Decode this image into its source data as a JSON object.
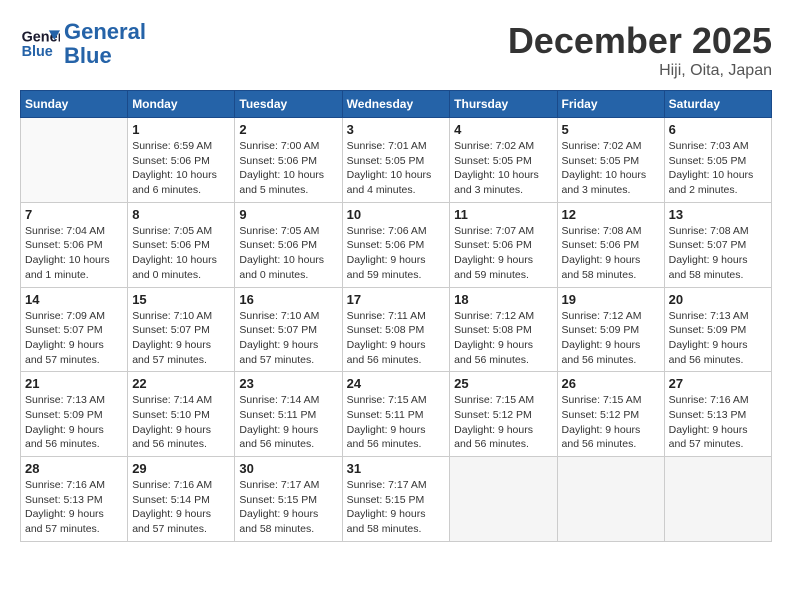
{
  "header": {
    "logo_line1": "General",
    "logo_line2": "Blue",
    "month_title": "December 2025",
    "location": "Hiji, Oita, Japan"
  },
  "days_of_week": [
    "Sunday",
    "Monday",
    "Tuesday",
    "Wednesday",
    "Thursday",
    "Friday",
    "Saturday"
  ],
  "weeks": [
    [
      {
        "day": "",
        "detail": ""
      },
      {
        "day": "1",
        "detail": "Sunrise: 6:59 AM\nSunset: 5:06 PM\nDaylight: 10 hours\nand 6 minutes."
      },
      {
        "day": "2",
        "detail": "Sunrise: 7:00 AM\nSunset: 5:06 PM\nDaylight: 10 hours\nand 5 minutes."
      },
      {
        "day": "3",
        "detail": "Sunrise: 7:01 AM\nSunset: 5:05 PM\nDaylight: 10 hours\nand 4 minutes."
      },
      {
        "day": "4",
        "detail": "Sunrise: 7:02 AM\nSunset: 5:05 PM\nDaylight: 10 hours\nand 3 minutes."
      },
      {
        "day": "5",
        "detail": "Sunrise: 7:02 AM\nSunset: 5:05 PM\nDaylight: 10 hours\nand 3 minutes."
      },
      {
        "day": "6",
        "detail": "Sunrise: 7:03 AM\nSunset: 5:05 PM\nDaylight: 10 hours\nand 2 minutes."
      }
    ],
    [
      {
        "day": "7",
        "detail": "Sunrise: 7:04 AM\nSunset: 5:06 PM\nDaylight: 10 hours\nand 1 minute."
      },
      {
        "day": "8",
        "detail": "Sunrise: 7:05 AM\nSunset: 5:06 PM\nDaylight: 10 hours\nand 0 minutes."
      },
      {
        "day": "9",
        "detail": "Sunrise: 7:05 AM\nSunset: 5:06 PM\nDaylight: 10 hours\nand 0 minutes."
      },
      {
        "day": "10",
        "detail": "Sunrise: 7:06 AM\nSunset: 5:06 PM\nDaylight: 9 hours\nand 59 minutes."
      },
      {
        "day": "11",
        "detail": "Sunrise: 7:07 AM\nSunset: 5:06 PM\nDaylight: 9 hours\nand 59 minutes."
      },
      {
        "day": "12",
        "detail": "Sunrise: 7:08 AM\nSunset: 5:06 PM\nDaylight: 9 hours\nand 58 minutes."
      },
      {
        "day": "13",
        "detail": "Sunrise: 7:08 AM\nSunset: 5:07 PM\nDaylight: 9 hours\nand 58 minutes."
      }
    ],
    [
      {
        "day": "14",
        "detail": "Sunrise: 7:09 AM\nSunset: 5:07 PM\nDaylight: 9 hours\nand 57 minutes."
      },
      {
        "day": "15",
        "detail": "Sunrise: 7:10 AM\nSunset: 5:07 PM\nDaylight: 9 hours\nand 57 minutes."
      },
      {
        "day": "16",
        "detail": "Sunrise: 7:10 AM\nSunset: 5:07 PM\nDaylight: 9 hours\nand 57 minutes."
      },
      {
        "day": "17",
        "detail": "Sunrise: 7:11 AM\nSunset: 5:08 PM\nDaylight: 9 hours\nand 56 minutes."
      },
      {
        "day": "18",
        "detail": "Sunrise: 7:12 AM\nSunset: 5:08 PM\nDaylight: 9 hours\nand 56 minutes."
      },
      {
        "day": "19",
        "detail": "Sunrise: 7:12 AM\nSunset: 5:09 PM\nDaylight: 9 hours\nand 56 minutes."
      },
      {
        "day": "20",
        "detail": "Sunrise: 7:13 AM\nSunset: 5:09 PM\nDaylight: 9 hours\nand 56 minutes."
      }
    ],
    [
      {
        "day": "21",
        "detail": "Sunrise: 7:13 AM\nSunset: 5:09 PM\nDaylight: 9 hours\nand 56 minutes."
      },
      {
        "day": "22",
        "detail": "Sunrise: 7:14 AM\nSunset: 5:10 PM\nDaylight: 9 hours\nand 56 minutes."
      },
      {
        "day": "23",
        "detail": "Sunrise: 7:14 AM\nSunset: 5:11 PM\nDaylight: 9 hours\nand 56 minutes."
      },
      {
        "day": "24",
        "detail": "Sunrise: 7:15 AM\nSunset: 5:11 PM\nDaylight: 9 hours\nand 56 minutes."
      },
      {
        "day": "25",
        "detail": "Sunrise: 7:15 AM\nSunset: 5:12 PM\nDaylight: 9 hours\nand 56 minutes."
      },
      {
        "day": "26",
        "detail": "Sunrise: 7:15 AM\nSunset: 5:12 PM\nDaylight: 9 hours\nand 56 minutes."
      },
      {
        "day": "27",
        "detail": "Sunrise: 7:16 AM\nSunset: 5:13 PM\nDaylight: 9 hours\nand 57 minutes."
      }
    ],
    [
      {
        "day": "28",
        "detail": "Sunrise: 7:16 AM\nSunset: 5:13 PM\nDaylight: 9 hours\nand 57 minutes."
      },
      {
        "day": "29",
        "detail": "Sunrise: 7:16 AM\nSunset: 5:14 PM\nDaylight: 9 hours\nand 57 minutes."
      },
      {
        "day": "30",
        "detail": "Sunrise: 7:17 AM\nSunset: 5:15 PM\nDaylight: 9 hours\nand 58 minutes."
      },
      {
        "day": "31",
        "detail": "Sunrise: 7:17 AM\nSunset: 5:15 PM\nDaylight: 9 hours\nand 58 minutes."
      },
      {
        "day": "",
        "detail": ""
      },
      {
        "day": "",
        "detail": ""
      },
      {
        "day": "",
        "detail": ""
      }
    ]
  ]
}
